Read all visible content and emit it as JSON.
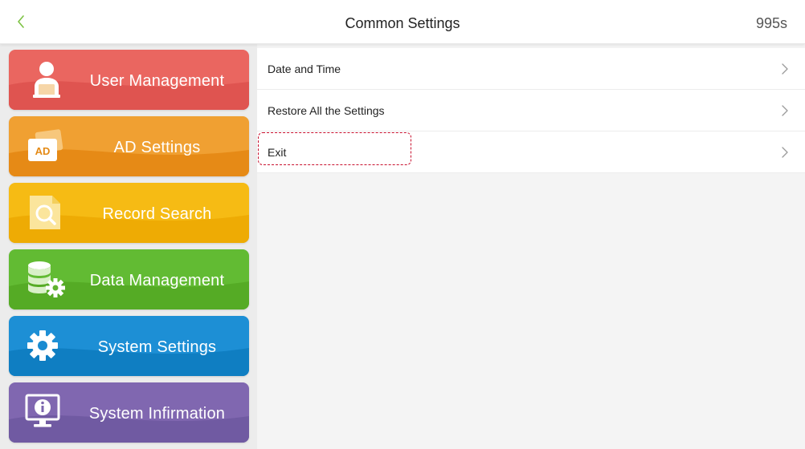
{
  "header": {
    "title": "Common Settings",
    "countdown": "995s"
  },
  "sidebar": {
    "items": [
      {
        "label": "User Management",
        "icon": "user-icon",
        "color": "#e8635d"
      },
      {
        "label": "AD Settings",
        "icon": "ad-icon",
        "color": "#ee9a2e",
        "icon_text": "AD"
      },
      {
        "label": "Record Search",
        "icon": "record-search-icon",
        "color": "#f4b711"
      },
      {
        "label": "Data Management",
        "icon": "database-gear-icon",
        "color": "#5eb831"
      },
      {
        "label": "System Settings",
        "icon": "gear-icon",
        "color": "#198bd2"
      },
      {
        "label": "System Infirmation",
        "icon": "info-monitor-icon",
        "color": "#7c65ae"
      }
    ]
  },
  "menu": {
    "items": [
      {
        "label": "Date and Time"
      },
      {
        "label": "Restore All the Settings"
      },
      {
        "label": "Exit"
      }
    ],
    "focused_index": 2
  },
  "colors": {
    "accent_back": "#7cc242",
    "focus_border": "#c8102e",
    "chevron": "#9a9a9a"
  }
}
